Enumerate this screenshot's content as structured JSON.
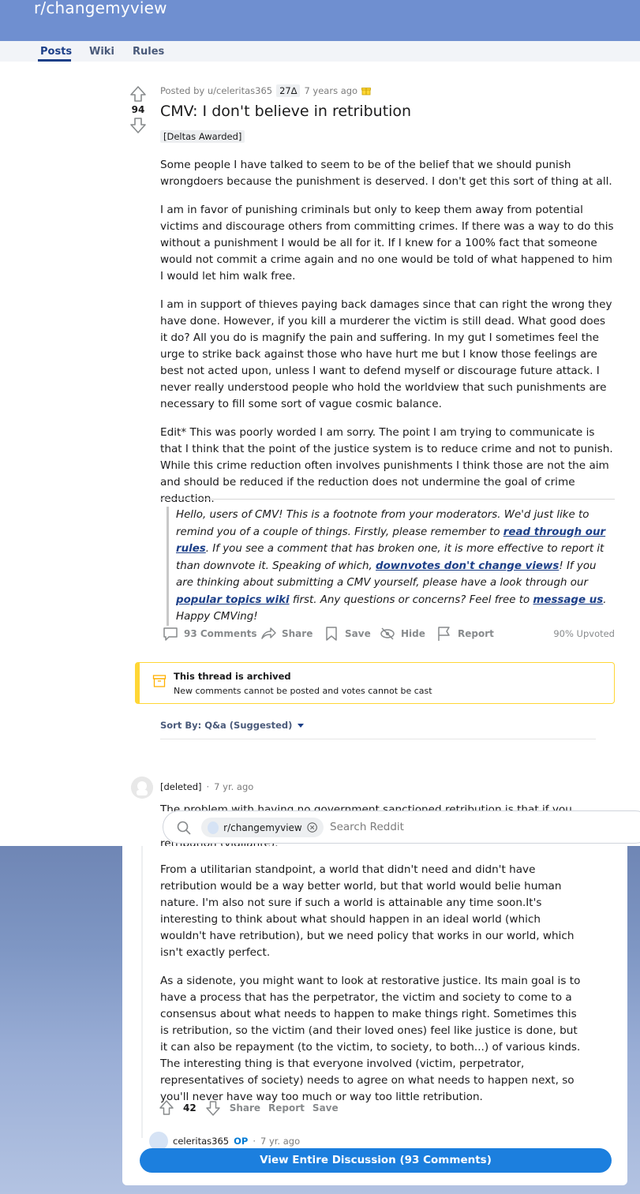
{
  "subreddit": {
    "name": "r/changemyview",
    "nav": [
      "Posts",
      "Wiki",
      "Rules"
    ],
    "active_nav": "Posts"
  },
  "post": {
    "score": "94",
    "posted_by": "Posted by u/celeritas365",
    "delta_flair": "27∆",
    "time": "7 years ago",
    "title": "CMV: I don't believe in retribution",
    "flair": "[Deltas Awarded]",
    "body": [
      "Some people I have talked to seem to be of the belief that we should punish wrongdoers because the punishment is deserved. I don't get this sort of thing at all.",
      "I am in favor of punishing criminals but only to keep them away from potential victims and discourage others from committing crimes. If there was a way to do this without a punishment I would be all for it. If I knew for a 100% fact that someone would not commit a crime again and no one would be told of what happened to him I would let him walk free.",
      "I am in support of thieves paying back damages since that can right the wrong they have done. However, if you kill a murderer the victim is still dead. What good does it do? All you do is magnify the pain and suffering. In my gut I sometimes feel the urge to strike back against those who have hurt me but I know those feelings are best not acted upon, unless I want to defend myself or discourage future attack. I never really understood people who hold the worldview that such punishments are necessary to fill some sort of vague cosmic balance.",
      "Edit* This was poorly worded I am sorry. The point I am trying to communicate is that I think that the point of the justice system is to reduce crime and not to punish. While this crime reduction often involves punishments I think those are not the aim and should be reduced if the reduction does not undermine the goal of crime reduction."
    ],
    "mod_note": {
      "t1": "Hello, users of CMV! This is a footnote from your moderators. We'd just like to remind you of a couple of things. Firstly, please remember to ",
      "l1": "read through our rules",
      "t2": ". If you see a comment that has broken one, it is more effective to report it than downvote it. Speaking of which, ",
      "l2": "downvotes don't change views",
      "t3": "! If you are thinking about submitting a CMV yourself, please have a look through our ",
      "l3": "popular topics wiki",
      "t4": " first. Any questions or concerns? Feel free to ",
      "l4": "message us",
      "t5": ". Happy CMVing!"
    },
    "actions": {
      "comments": "93 Comments",
      "share": "Share",
      "save": "Save",
      "hide": "Hide",
      "report": "Report",
      "upvoted": "90% Upvoted"
    }
  },
  "archive": {
    "title": "This thread is archived",
    "subtitle": "New comments cannot be posted and votes cannot be cast"
  },
  "sort": {
    "label": "Sort By: Q&a (Suggested)"
  },
  "comment": {
    "user": "[deleted]",
    "time": "7 yr. ago",
    "partial_first": "The problem with having no government sanctioned retribution is that if you",
    "partial_second": "retribution (vigilante).",
    "body": [
      "From a utilitarian standpoint, a world that didn't need and didn't have retribution would be a way better world, but that world would belie human nature. I'm also not sure if such a world is attainable any time soon.It's interesting to think about what should happen in an ideal world (which wouldn't have retribution), but we need policy that works in our world, which isn't exactly perfect.",
      "As a sidenote, you might want to look at restorative justice. Its main goal is to have a process that has the perpetrator, the victim and society to come to a consensus about what needs to happen to make things right. Sometimes this is retribution, so the victim (and their loved ones) feel like justice is done, but it can also be repayment (to the victim, to society, to both...) of various kinds. The interesting thing is that everyone involved (victim, perpetrator, representatives of society) needs to agree on what needs to happen next, so you'll never have way too much or way too little retribution."
    ],
    "score": "42",
    "share": "Share",
    "report": "Report",
    "save": "Save"
  },
  "reply": {
    "user": "celeritas365",
    "badge": "OP",
    "time": "7 yr. ago"
  },
  "search": {
    "chip": "r/changemyview",
    "placeholder": "Search Reddit"
  },
  "view_all": "View Entire Discussion (93 Comments)",
  "colors": {
    "header": "#6f8fd0",
    "accent": "#1c7fde",
    "archive_border": "#ffd635"
  }
}
